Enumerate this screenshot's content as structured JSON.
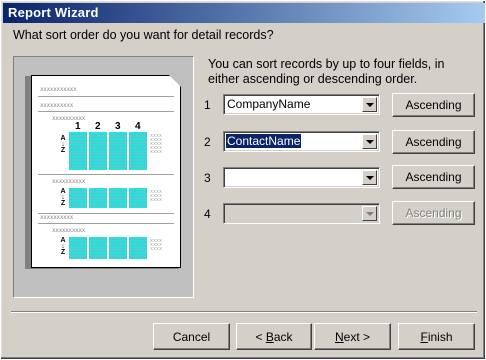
{
  "window": {
    "title": "Report Wizard"
  },
  "question": "What sort order do you want for detail records?",
  "info_text": "You can sort records by up to four fields, in either ascending or descending order.",
  "preview": {
    "x_group_label": "xxxxxxxxxxx",
    "x_sub_label": "xxxxxxxxxx",
    "x_row_label": "xxxxxxxxxx",
    "column_numbers": [
      "1",
      "2",
      "3",
      "4"
    ],
    "sort_glyph_top": "A",
    "sort_glyph_arrow": "↓",
    "sort_glyph_bottom": "Z",
    "gray_cells": "xxxx"
  },
  "sort_fields": [
    {
      "number": "1",
      "value": "CompanyName",
      "order": "Ascending",
      "enabled": true,
      "selected": false
    },
    {
      "number": "2",
      "value": "ContactName",
      "order": "Ascending",
      "enabled": true,
      "selected": true
    },
    {
      "number": "3",
      "value": "",
      "order": "Ascending",
      "enabled": true,
      "selected": false
    },
    {
      "number": "4",
      "value": "",
      "order": "Ascending",
      "enabled": false,
      "selected": false
    }
  ],
  "buttons": {
    "cancel": "Cancel",
    "back": "< Back",
    "back_mnemonic": "B",
    "next": "Next >",
    "next_mnemonic": "N",
    "finish": "Finish",
    "finish_mnemonic": "F"
  }
}
